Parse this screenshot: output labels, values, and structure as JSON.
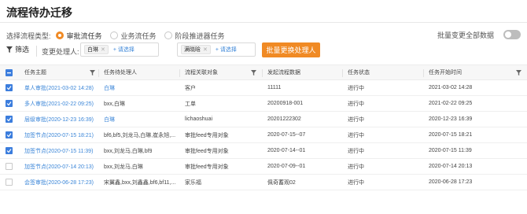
{
  "page": {
    "title": "流程待办迁移"
  },
  "type_selector": {
    "label": "选择流程类型:",
    "options": [
      {
        "label": "审批流任务",
        "selected": true
      },
      {
        "label": "业务流任务",
        "selected": false
      },
      {
        "label": "阶段推进器任务",
        "selected": false
      }
    ]
  },
  "toggle": {
    "label": "批量变更全部数据",
    "on": false
  },
  "toolbar": {
    "filter_label": "筛选",
    "change_handler_label": "变更处理人:",
    "from_tag": "白琳",
    "from_add": "+ 请选择",
    "to_tag": "满晓晗",
    "to_add": "+ 请选择",
    "batch_button": "批量更换处理人"
  },
  "table": {
    "headers": [
      "任务主题",
      "任务待处理人",
      "流程关联对象",
      "发起流程数据",
      "任务状态",
      "任务开始时间"
    ],
    "rows": [
      {
        "checked": true,
        "subject": "单人审批(2021-03-02 14:28)",
        "handler": "白琳",
        "handler_link": true,
        "object": "客户",
        "data": "11111",
        "status": "进行中",
        "start": "2021-03-02 14:28"
      },
      {
        "checked": true,
        "subject": "多人审批(2021-02-22 09:25)",
        "handler": "bxx,白琳",
        "handler_link": false,
        "object": "工单",
        "data": "20200918-001",
        "status": "进行中",
        "start": "2021-02-22 09:25"
      },
      {
        "checked": true,
        "subject": "层级审批(2020-12-23 16:39)",
        "handler": "白琳",
        "handler_link": true,
        "object": "lichaoshuai",
        "data": "20201222302",
        "status": "进行中",
        "start": "2020-12-23 16:39"
      },
      {
        "checked": true,
        "subject": "加签节点(2020-07-15 18:21)",
        "handler": "bf6,bf5,刘龙马,白琳,崔永旭,...",
        "handler_link": false,
        "object": "审批feed专用对象",
        "data": "2020-07-15--07",
        "status": "进行中",
        "start": "2020-07-15 18:21"
      },
      {
        "checked": true,
        "subject": "加签节点(2020-07-15 11:39)",
        "handler": "bxx,刘龙马,白琳,bf9",
        "handler_link": false,
        "object": "审批feed专用对象",
        "data": "2020-07-14--01",
        "status": "进行中",
        "start": "2020-07-15 11:39"
      },
      {
        "checked": false,
        "subject": "加签节点(2020-07-14 20:13)",
        "handler": "bxx,刘龙马,白琳",
        "handler_link": false,
        "object": "审批feed专用对象",
        "data": "2020-07-09--01",
        "status": "进行中",
        "start": "2020-07-14 20:13"
      },
      {
        "checked": false,
        "subject": "会签审批(2020-06-28 17:23)",
        "handler": "宋翼鑫,bxx,刘鑫鑫,bf6,bf11,...",
        "handler_link": false,
        "object": "家乐福",
        "data": "佩奇蓄观02",
        "status": "进行中",
        "start": "2020-06-28 17:23"
      }
    ]
  },
  "colors": {
    "accent": "#f08a24",
    "link": "#3b86d8",
    "checkbox": "#3b7ddd"
  }
}
